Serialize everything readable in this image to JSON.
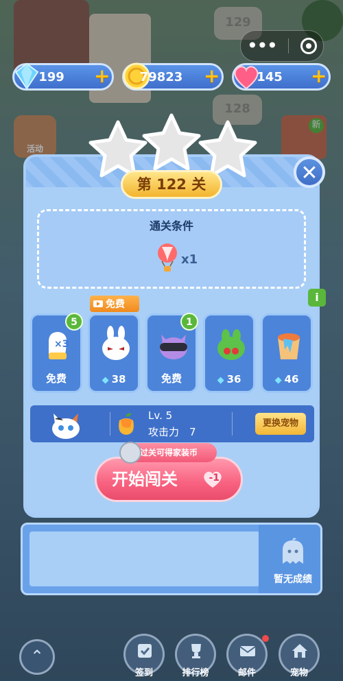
{
  "window": {
    "capsule_menu_icon": "more-dots-icon",
    "capsule_close_icon": "target-icon"
  },
  "currency": {
    "diamonds": "199",
    "coins": "79823",
    "lives": "145"
  },
  "level": {
    "title": "第 122 关",
    "stars_earned": 0,
    "stars_total": 3
  },
  "clear_condition": {
    "title": "通关条件",
    "item_icon": "hot-air-balloon-icon",
    "count": "x1"
  },
  "free_banner": "免费",
  "info_tag": "i",
  "boosters": [
    {
      "icon": "glove-plus3-icon",
      "price": "免费",
      "count": "5",
      "diamond": false
    },
    {
      "icon": "bunny-icon",
      "price": "38",
      "count": null,
      "diamond": true
    },
    {
      "icon": "cat-goggles-icon",
      "price": "免费",
      "count": "1",
      "diamond": false
    },
    {
      "icon": "frog-icon",
      "price": "36",
      "count": null,
      "diamond": true
    },
    {
      "icon": "paint-bucket-icon",
      "price": "46",
      "count": null,
      "diamond": true
    }
  ],
  "pet": {
    "level": "Lv. 5",
    "attack": "攻击力　7",
    "change_label": "更换宠物",
    "fruit_icon": "mango-icon"
  },
  "reward_hint": "过关可得家装币",
  "start": {
    "label": "开始闯关",
    "cost": "-1"
  },
  "score": {
    "empty_text": "暂无成绩"
  },
  "nav": [
    {
      "label": "签到",
      "icon": "checkin-icon"
    },
    {
      "label": "排行榜",
      "icon": "trophy-icon"
    },
    {
      "label": "邮件",
      "icon": "mail-icon"
    },
    {
      "label": "宠物",
      "icon": "house-icon"
    }
  ],
  "background_labels": {
    "level_129": "129",
    "level_128": "128",
    "new_badge": "新",
    "event_label": "活动"
  },
  "colors": {
    "panel": "#7fb2ef",
    "accent_green": "#5ab73b",
    "start_button": "#f8617f",
    "badge_gold": "#f3b52e"
  }
}
